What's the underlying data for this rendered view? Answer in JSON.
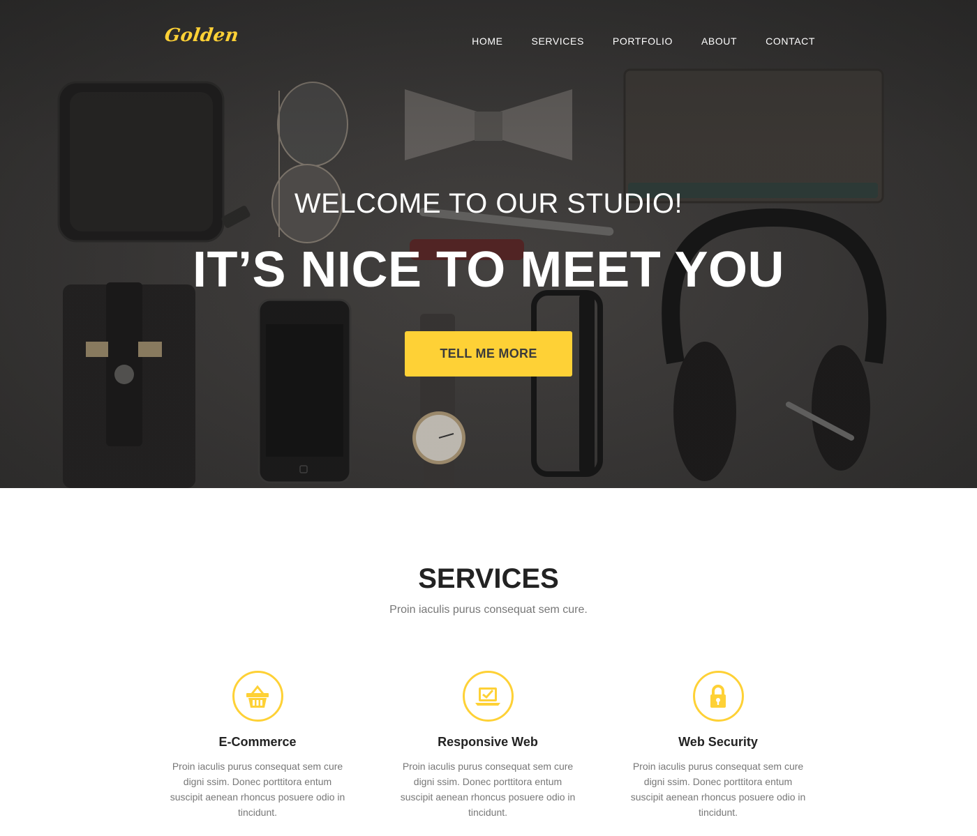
{
  "brand": {
    "logo_text": "Golden",
    "accent_color": "#fed136"
  },
  "nav": {
    "items": [
      {
        "label": "HOME"
      },
      {
        "label": "SERVICES"
      },
      {
        "label": "PORTFOLIO"
      },
      {
        "label": "ABOUT"
      },
      {
        "label": "CONTACT"
      }
    ]
  },
  "hero": {
    "lead": "WELCOME TO OUR STUDIO!",
    "heading": "IT’S NICE TO MEET YOU",
    "button_label": "TELL ME MORE",
    "background": "flat-lay-accessories-photo"
  },
  "services": {
    "title": "SERVICES",
    "subtitle": "Proin iaculis purus consequat sem cure.",
    "items": [
      {
        "icon": "basket-icon",
        "title": "E-Commerce",
        "text": "Proin iaculis purus consequat sem cure digni ssim. Donec porttitora entum suscipit aenean rhoncus posuere odio in tincidunt."
      },
      {
        "icon": "laptop-check-icon",
        "title": "Responsive Web",
        "text": "Proin iaculis purus consequat sem cure digni ssim. Donec porttitora entum suscipit aenean rhoncus posuere odio in tincidunt."
      },
      {
        "icon": "lock-icon",
        "title": "Web Security",
        "text": "Proin iaculis purus consequat sem cure digni ssim. Donec porttitora entum suscipit aenean rhoncus posuere odio in tincidunt."
      }
    ]
  }
}
